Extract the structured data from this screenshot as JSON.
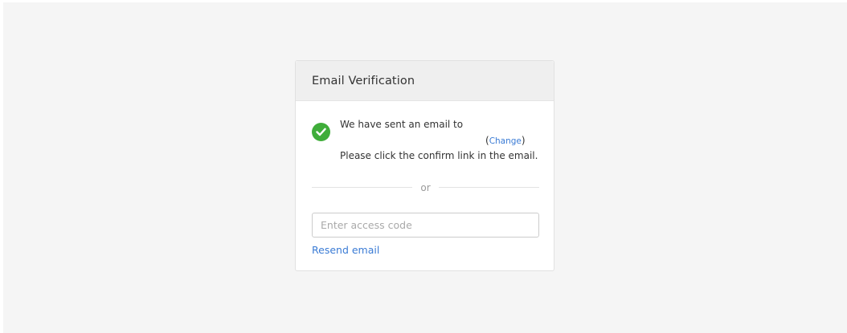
{
  "card": {
    "title": "Email Verification",
    "message": {
      "line1": "We have sent an email to",
      "change_open": "(",
      "change_label": "Change",
      "change_close": ")",
      "line3": "Please click the confirm link in the email."
    },
    "divider_text": "or",
    "access_code": {
      "value": "",
      "placeholder": "Enter access code"
    },
    "resend_label": "Resend email"
  },
  "colors": {
    "page_background": "#f5f5f5",
    "header_background": "#efefef",
    "success_icon": "#3fad3a",
    "link": "#3a7bd5"
  },
  "icons": {
    "status": "check-circle-icon"
  }
}
